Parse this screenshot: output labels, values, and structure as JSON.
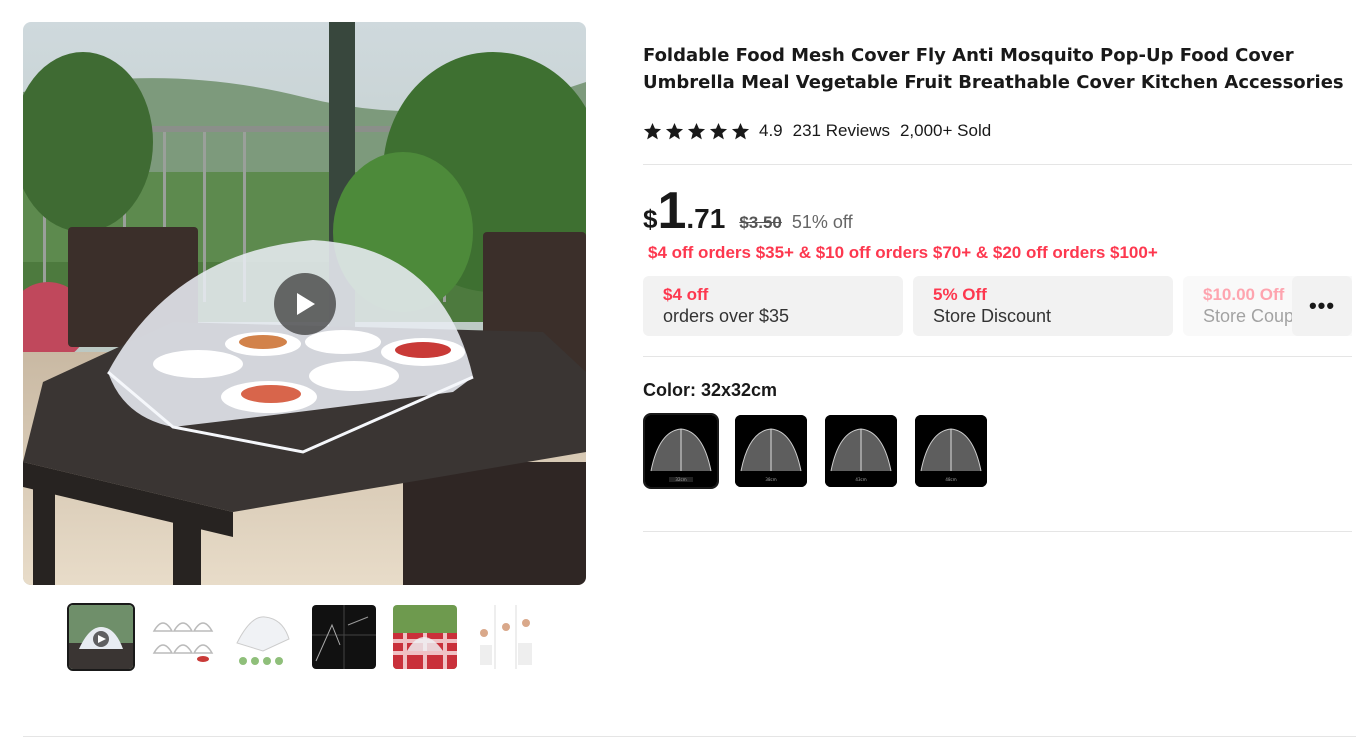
{
  "product": {
    "title": "Foldable Food Mesh Cover Fly Anti Mosquito Pop-Up Food Cover Umbrella Meal Vegetable Fruit Breathable Cover Kitchen Accessories",
    "rating": "4.9",
    "reviews": "231 Reviews",
    "sold": "2,000+ Sold",
    "star_count": 5
  },
  "price": {
    "currency": "$",
    "integer": "1",
    "decimal": ".71",
    "original": "$3.50",
    "discount": "51% off",
    "promo": "$4 off orders $35+ & $10 off orders $70+ & $20 off orders $100+"
  },
  "coupons": [
    {
      "title": "$4 off",
      "subtitle": "orders over $35"
    },
    {
      "title": "5% Off",
      "subtitle": "Store Discount"
    },
    {
      "title": "$10.00 Off",
      "subtitle": "Store Coupon"
    }
  ],
  "more_label": "•••",
  "color": {
    "label": "Color: 32x32cm",
    "options": [
      "32cm",
      "38cm",
      "43cm",
      "48cm"
    ],
    "selected_index": 0
  },
  "gallery": {
    "thumbnail_count": 6,
    "active_index": 0
  },
  "colors": {
    "accent": "#fd384f",
    "text": "#191919",
    "coupon_bg": "#f2f2f2"
  }
}
